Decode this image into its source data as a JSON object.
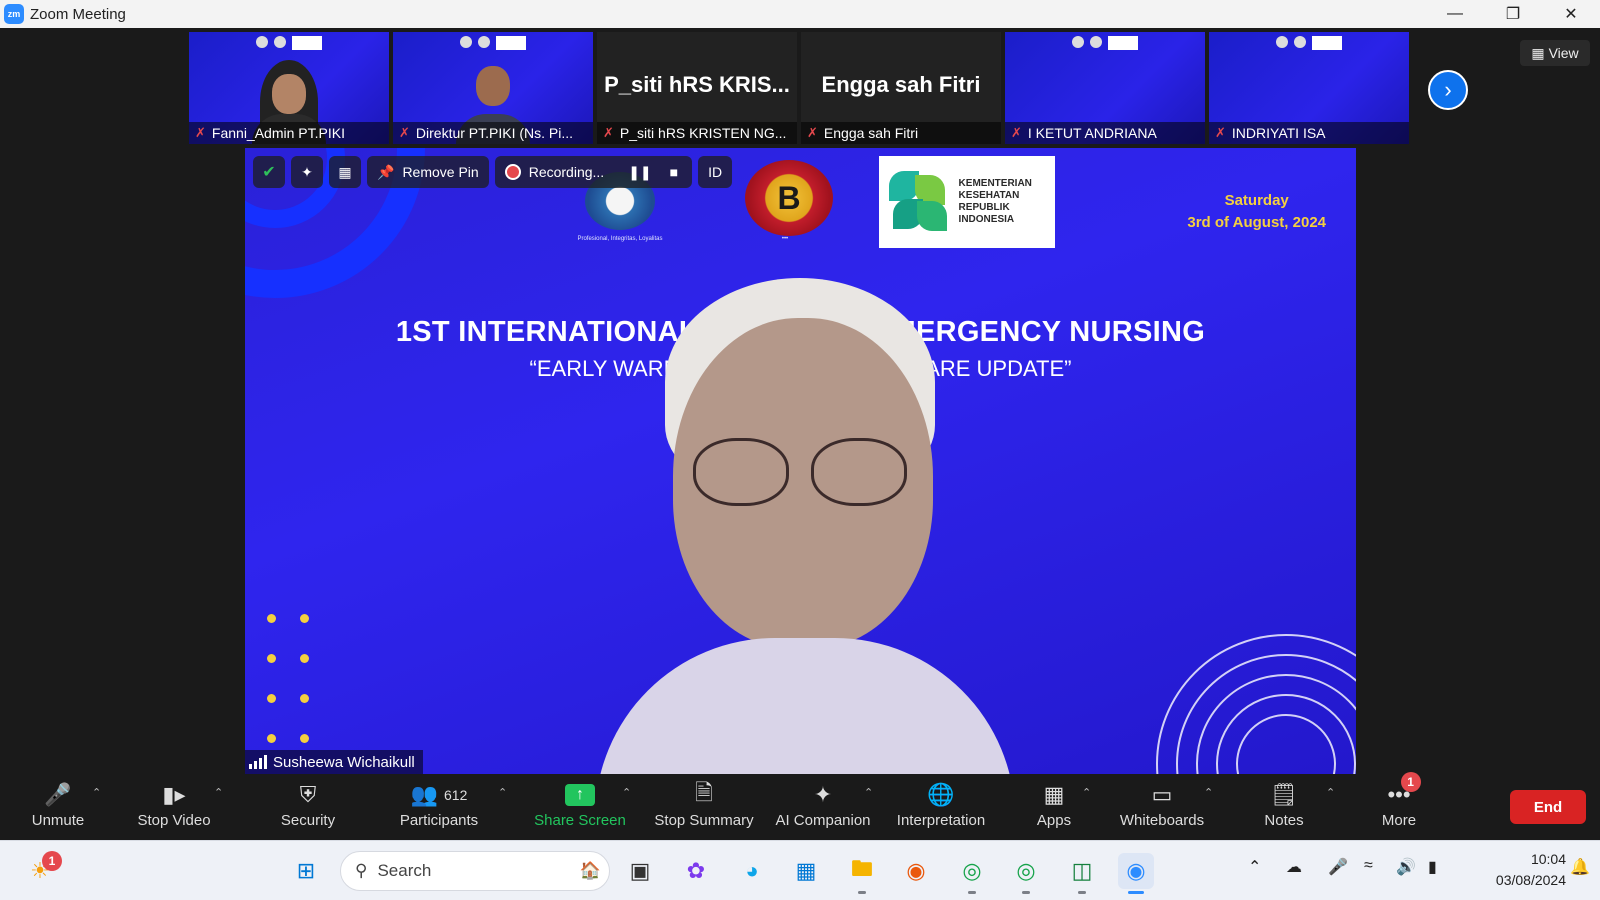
{
  "window": {
    "title": "Zoom Meeting",
    "app_icon": "zm"
  },
  "strip": {
    "tiles": [
      {
        "name": "Fanni_Admin PT.PIKI",
        "kind": "slide-person"
      },
      {
        "name": "Direktur PT.PIKI (Ns. Pi...",
        "kind": "slide-person"
      },
      {
        "name": "P_siti hRS KRISTEN NG...",
        "big": "P_siti hRS KRIS...",
        "kind": "name"
      },
      {
        "name": "Engga sah Fitri",
        "big": "Engga sah Fitri",
        "kind": "name"
      },
      {
        "name": "I KETUT ANDRIANA",
        "kind": "slide"
      },
      {
        "name": "INDRIYATI ISA",
        "kind": "slide"
      }
    ],
    "view_label": "View"
  },
  "main": {
    "controls": {
      "pin_label": "Remove Pin",
      "recording_label": "Recording...",
      "id_label": "ID"
    },
    "slide": {
      "date_day": "Saturday",
      "date_full": "3rd of August, 2024",
      "title": "1ST INTERNATIONAL S                    MERGENCY NURSING",
      "subtitle": "“EARLY WARNIN                                  CARE UPDATE”",
      "kemenkes": "KEMENTERIAN KESEHATAN REPUBLIK INDONESIA",
      "logo1_caption": "Profesional, Integritas, Loyalitas",
      "logo2_letter": "B"
    },
    "speaker_name": "Susheewa Wichaikull"
  },
  "toolbar": {
    "unmute": "Unmute",
    "stop_video": "Stop Video",
    "security": "Security",
    "participants": "Participants",
    "participant_count": "612",
    "share_screen": "Share Screen",
    "stop_summary": "Stop Summary",
    "ai_companion": "AI Companion",
    "interpretation": "Interpretation",
    "apps": "Apps",
    "whiteboards": "Whiteboards",
    "notes": "Notes",
    "more": "More",
    "more_badge": "1",
    "end": "End"
  },
  "taskbar": {
    "search_placeholder": "Search",
    "widget_badge": "1",
    "time": "10:04",
    "date": "03/08/2024"
  },
  "colors": {
    "accent": "#0e72ed",
    "end": "#d92323",
    "share": "#22c55e",
    "slide_bg": "#2a21d8"
  }
}
